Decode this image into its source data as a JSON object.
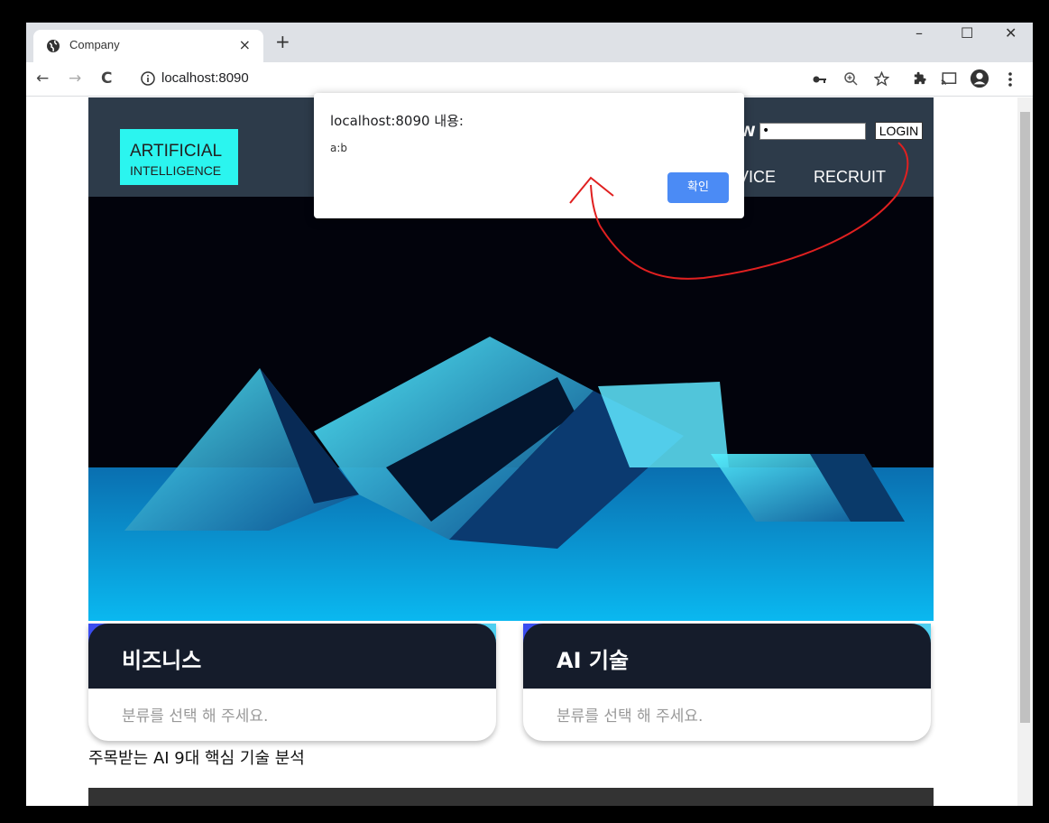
{
  "browser": {
    "tab_title": "Company",
    "tab_close": "×",
    "new_tab": "+",
    "minimize": "–",
    "maximize": "☐",
    "close": "✕",
    "back": "←",
    "forward": "→",
    "reload": "C",
    "url": "localhost:8090",
    "icons": [
      "key-icon",
      "zoom-icon",
      "star-icon",
      "extensions-icon",
      "cast-icon",
      "profile-icon",
      "menu-icon"
    ]
  },
  "header": {
    "logo_line1": "ARTIFICIAL",
    "logo_line2": "INTELLIGENCE",
    "pw_label": "W",
    "pw_value": "•",
    "login_label": "LOGIN",
    "menu": [
      "VICE",
      "RECRUIT"
    ]
  },
  "cards": [
    {
      "title": "비즈니스",
      "subtitle": "분류를 선택 해 주세요."
    },
    {
      "title": "AI 기술",
      "subtitle": "분류를 선택 해 주세요."
    }
  ],
  "caption": "주목받는 AI 9대 핵심 기술 분석",
  "dialog": {
    "title": "localhost:8090 내용:",
    "message": "a:b",
    "ok_label": "확인"
  },
  "colors": {
    "header_bg": "#2d3b4a",
    "logo_bg": "#2bf5ef",
    "ok_button": "#4b8bf5",
    "annotation": "#e02020"
  }
}
